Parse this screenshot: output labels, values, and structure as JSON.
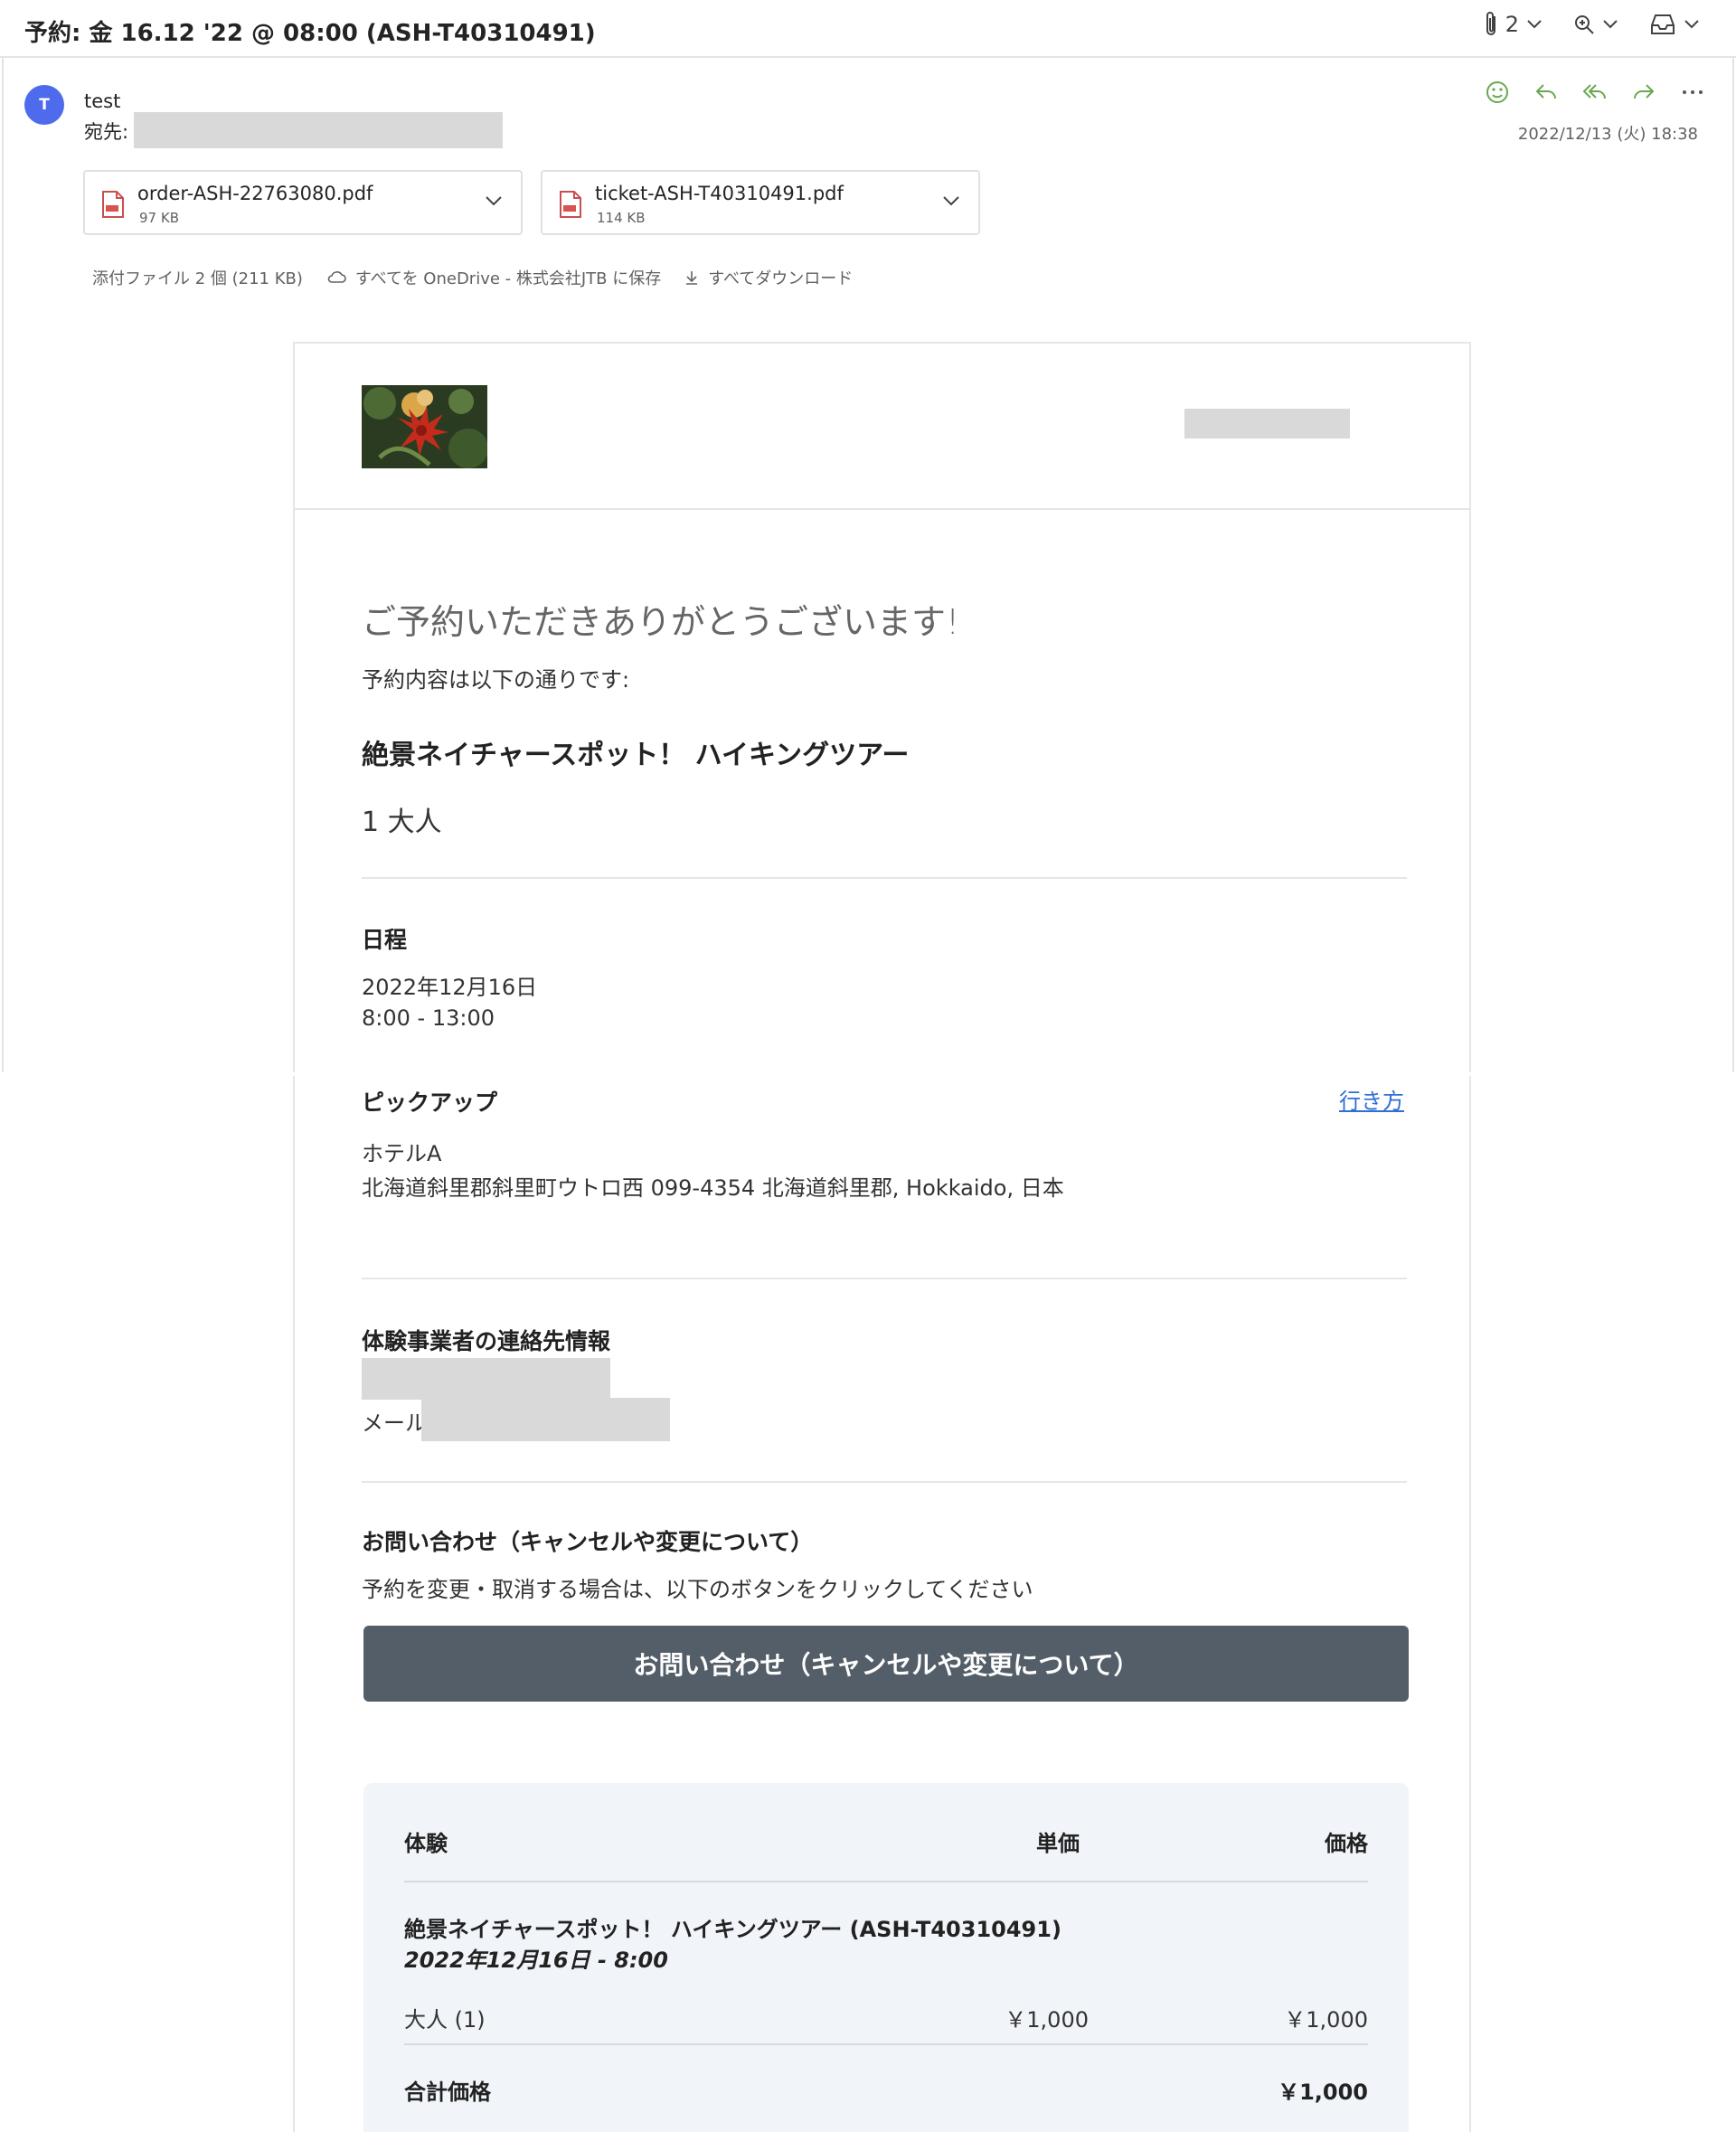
{
  "header": {
    "subject": "予約: 金 16.12 '22 @ 08:00 (ASH-T40310491)",
    "attachment_count": "2"
  },
  "message": {
    "avatar_initial": "T",
    "sender": "test",
    "to_label": "宛先:",
    "timestamp": "2022/12/13 (火) 18:38"
  },
  "attachments": [
    {
      "name": "order-ASH-22763080.pdf",
      "size": "97 KB"
    },
    {
      "name": "ticket-ASH-T40310491.pdf",
      "size": "114 KB"
    }
  ],
  "attachment_bar": {
    "summary": "添付ファイル 2 個 (211 KB)",
    "save_onedrive": "すべてを OneDrive - 株式会社JTB に保存",
    "download_all": "すべてダウンロード"
  },
  "email": {
    "thanks": "ご予約いただきありがとうございます!",
    "intro": "予約内容は以下の通りです:",
    "tour_name": "絶景ネイチャースポット！ ハイキングツアー",
    "participants": "1 大人",
    "schedule": {
      "title": "日程",
      "date": "2022年12月16日",
      "time": "8:00 - 13:00"
    },
    "pickup": {
      "title": "ピックアップ",
      "directions": "行き方",
      "place": "ホテルA",
      "address": "北海道斜里郡斜里町ウトロ西 099-4354 北海道斜里郡, Hokkaido, 日本"
    },
    "contact": {
      "title": "体験事業者の連絡先情報",
      "mail_label": "メール"
    },
    "inquiry": {
      "title": "お問い合わせ（キャンセルや変更について）",
      "text": "予約を変更・取消する場合は、以下のボタンをクリックしてください",
      "button": "お問い合わせ（キャンセルや変更について）"
    },
    "price_table": {
      "headers": [
        "体験",
        "単価",
        "価格"
      ],
      "item_name": "絶景ネイチャースポット！ ハイキングツアー (ASH-T40310491)",
      "item_datetime": "2022年12月16日 - 8:00",
      "row": {
        "label": "大人 (1)",
        "unit_price": "￥1,000",
        "price": "￥1,000"
      },
      "total_label": "合計価格",
      "total": "￥1,000"
    }
  }
}
